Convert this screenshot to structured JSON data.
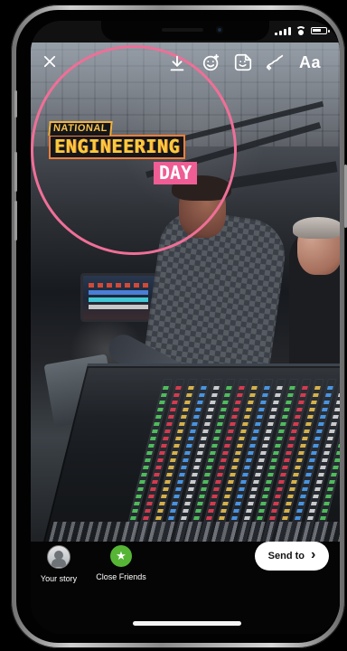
{
  "status_bar": {
    "signal_icon": "signal-icon",
    "wifi_icon": "wifi-icon",
    "battery_icon": "battery-icon"
  },
  "toolbar": {
    "close_icon": "close-icon",
    "download_icon": "download-icon",
    "face_effect_icon": "face-effect-icon",
    "sticker_icon": "sticker-icon",
    "draw_icon": "draw-icon",
    "text_tool_label": "Aa"
  },
  "story": {
    "sticker": {
      "top_line": "NATIONAL",
      "middle_line": "ENGINEERING",
      "bottom_line": "DAY"
    },
    "highlight_color": "#ef6f97"
  },
  "bottom": {
    "share_targets": [
      {
        "label": "Your story",
        "icon": "avatar"
      },
      {
        "label": "Close Friends",
        "icon": "star-icon"
      }
    ],
    "send_button_label": "Send to",
    "send_icon": "chevron-right-icon"
  }
}
